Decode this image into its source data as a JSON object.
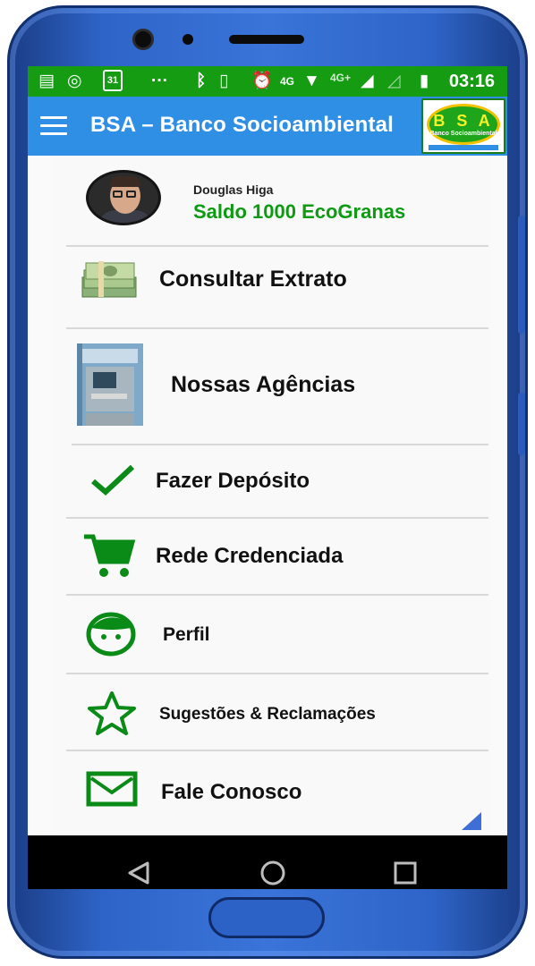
{
  "status_bar": {
    "time": "03:16",
    "icons": [
      "notes-icon",
      "whatsapp-icon",
      "calendar-icon",
      "more-icon",
      "bluetooth-icon",
      "vibrate-icon",
      "alarm-icon",
      "volte-icon",
      "wifi-icon",
      "signal-4g-icon",
      "signal-icon",
      "battery-icon"
    ],
    "calendar_day": "31",
    "dots": "···",
    "network": "4G+"
  },
  "app_bar": {
    "title": "BSA – Banco Socioambiental",
    "logo_letters": "B S A",
    "logo_subtitle": "Banco Socioambiental"
  },
  "user": {
    "name": "Douglas Higa",
    "balance": "Saldo 1000 EcoGranas"
  },
  "menu": {
    "statement": "Consultar  Extrato",
    "agencies": "Nossas Agências",
    "deposit": "Fazer Depósito",
    "network": "Rede Credenciada",
    "profile": "Perfil",
    "suggestions": "Sugestões & Reclamações",
    "contact": "Fale Conosco"
  },
  "colors": {
    "status_bar": "#159c13",
    "app_bar": "#2f8fe4",
    "icon_green": "#0a8a16",
    "balance_green": "#0e9a12",
    "phone_body": "#2e64c8"
  }
}
